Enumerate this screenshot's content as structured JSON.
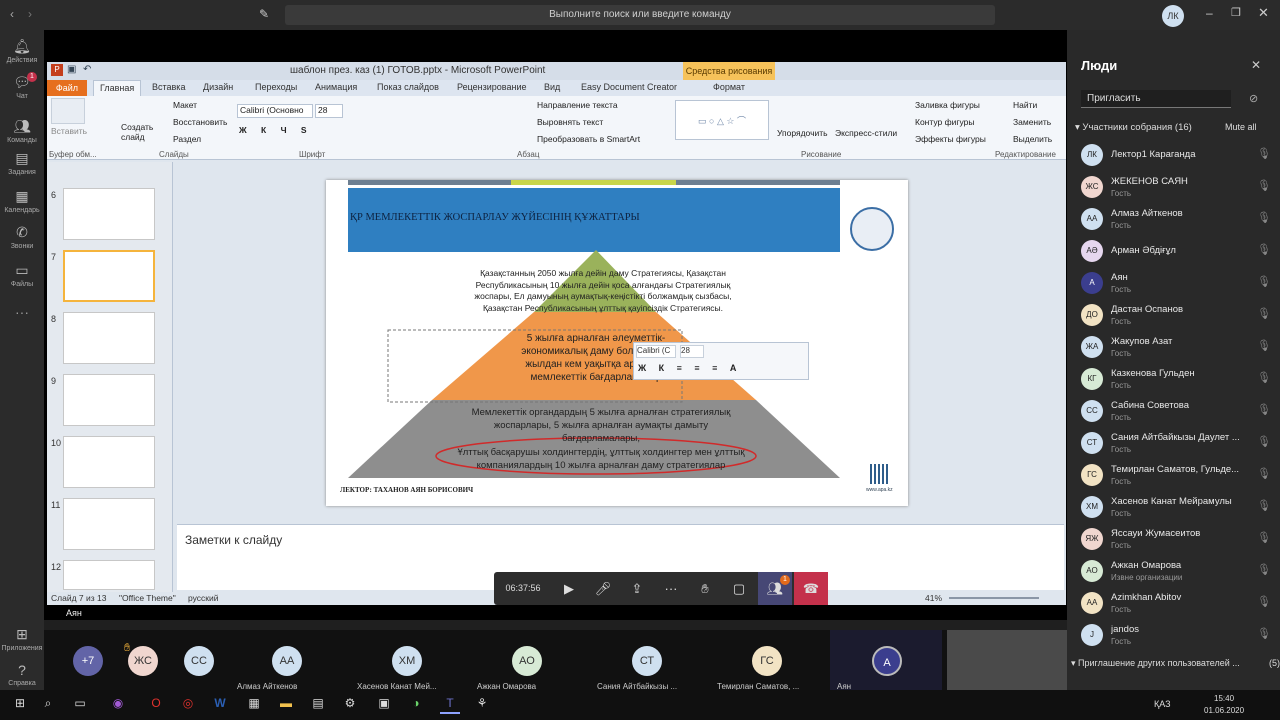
{
  "teams": {
    "search_placeholder": "Выполните поиск или введите команду",
    "user_initials": "ЛК",
    "rail": [
      {
        "label": "Действия",
        "icon": "bell-icon"
      },
      {
        "label": "Чат",
        "icon": "chat-icon",
        "badge": "1"
      },
      {
        "label": "Команды",
        "icon": "teams-icon"
      },
      {
        "label": "Задания",
        "icon": "assignments-icon"
      },
      {
        "label": "Календарь",
        "icon": "calendar-icon"
      },
      {
        "label": "Звонки",
        "icon": "phone-icon"
      },
      {
        "label": "Файлы",
        "icon": "files-icon"
      },
      {
        "label": "Приложения",
        "icon": "apps-icon"
      },
      {
        "label": "Справка",
        "icon": "help-icon"
      }
    ],
    "presenter_label": "Аян",
    "call_timer": "06:37:56",
    "participants_badge": "1"
  },
  "ppt": {
    "window_title": "шаблон през. каз (1) ГОТОВ.pptx - Microsoft PowerPoint",
    "context_tab": "Средства рисования",
    "tabs": [
      "Файл",
      "Главная",
      "Вставка",
      "Дизайн",
      "Переходы",
      "Анимация",
      "Показ слайдов",
      "Рецензирование",
      "Вид",
      "Easy Document Creator",
      "Формат"
    ],
    "ribbon": {
      "paste": "Вставить",
      "clipboard_group": "Буфер обм...",
      "new_slide": "Создать слайд",
      "layout": "Макет",
      "reset": "Восстановить",
      "section": "Раздел",
      "slides_group": "Слайды",
      "font_name": "Calibri (Основно",
      "font_size": "28",
      "font_group": "Шрифт",
      "text_direction": "Направление текста",
      "align_text": "Выровнять текст",
      "smartart": "Преобразовать в SmartArt",
      "paragraph_group": "Абзац",
      "arrange": "Упорядочить",
      "quick_styles": "Экспресс-стили",
      "shape_fill": "Заливка фигуры",
      "shape_outline": "Контур фигуры",
      "shape_effects": "Эффекты фигуры",
      "drawing_group": "Рисование",
      "find": "Найти",
      "replace": "Заменить",
      "select": "Выделить",
      "editing_group": "Редактирование"
    },
    "thumbnail_numbers": [
      "6",
      "7",
      "8",
      "9",
      "10",
      "11",
      "12"
    ],
    "slide": {
      "title": "ҚР МЕМЛЕКЕТТІК ЖОСПАРЛАУ ЖҮЙЕСІНІҢ ҚҰЖАТТАРЫ",
      "top_text": "Қазақстанның 2050 жылға дейін даму Стратегиясы, Қазақстан Республикасының 10 жылға дейін қоса алғандағы Стратегиялық жоспары, Ел дамуының аумақтық-кеңістікті болжамдық сызбасы, Қазақстан Республикасының ұлттық қауіпсіздік Стратегиясы.",
      "middle_text": "5 жылға арналған әлеуметтік-экономикалық даму болжамы, 5 жылдан кем уақытқа арналған мемлекеттік бағдарламалар",
      "bottom_text_1": "Мемлекеттік органдардың 5 жылға арналған стратегиялық жоспарлары, 5 жылға арналған аумақты дамыту бағдарламалары,",
      "bottom_text_2": "Ұлттық басқарушы холдингтердің, ұлттық холдингтер мен ұлттық компаниялардың 10 жылға арналған даму стратегиялар",
      "lecturer": "ЛЕКТОР: ТАХАНОВ АЯН БОРИСОВИЧ",
      "website": "www.apa.kz"
    },
    "mini_toolbar": {
      "font": "Calibri (С",
      "size": "28"
    },
    "notes_placeholder": "Заметки к слайду",
    "status": {
      "slide_info": "Слайд 7 из 13",
      "theme": "\"Office Theme\"",
      "language": "русский",
      "zoom": "41%"
    }
  },
  "meeting_strip": [
    {
      "initials": "+7",
      "color": "#6264a7",
      "name": ""
    },
    {
      "initials": "ЖС",
      "color": "#f0d6cf",
      "name": ""
    },
    {
      "initials": "СС",
      "color": "#cfe0f0",
      "name": ""
    },
    {
      "initials": "АА",
      "color": "#cfe0f0",
      "name": "Алмаз Айткенов"
    },
    {
      "initials": "ХМ",
      "color": "#cfe0f0",
      "name": "Хасенов Канат Мей..."
    },
    {
      "initials": "АО",
      "color": "#d7ead5",
      "name": "Ажкан Омарова"
    },
    {
      "initials": "СТ",
      "color": "#cfe0f0",
      "name": "Сания Айтбайкызы ..."
    },
    {
      "initials": "ГС",
      "color": "#f2e3c4",
      "name": "Темирлан Саматов, ..."
    },
    {
      "initials": "А",
      "color": "#3b3e8e",
      "name": "Аян"
    }
  ],
  "people_panel": {
    "title": "Люди",
    "invite_placeholder": "Пригласить",
    "participants_header": "Участники собрания (16)",
    "mute_all": "Mute all",
    "participants": [
      {
        "initials": "ЛК",
        "name": "Лектор1 Караганда",
        "role": "",
        "color": "#cfe0f0"
      },
      {
        "initials": "ЖС",
        "name": "ЖЕКЕНОВ САЯН",
        "role": "Гость",
        "color": "#f0d6cf"
      },
      {
        "initials": "АА",
        "name": "Алмаз Айткенов",
        "role": "Гость",
        "color": "#cfe0f0"
      },
      {
        "initials": "АӘ",
        "name": "Арман Әбдіғұл",
        "role": "",
        "color": "#e6d7ef"
      },
      {
        "initials": "А",
        "name": "Аян",
        "role": "Гость",
        "color": "#3b3e8e"
      },
      {
        "initials": "ДО",
        "name": "Дастан Оспанов",
        "role": "Гость",
        "color": "#f2e3c4"
      },
      {
        "initials": "ЖА",
        "name": "Жакупов Азат",
        "role": "Гость",
        "color": "#cfe0f0"
      },
      {
        "initials": "КГ",
        "name": "Казкенова Гульден",
        "role": "Гость",
        "color": "#d7ead5"
      },
      {
        "initials": "СС",
        "name": "Сабина Советова",
        "role": "Гость",
        "color": "#cfe0f0"
      },
      {
        "initials": "СТ",
        "name": "Сания Айтбайкызы Даулет ...",
        "role": "Гость",
        "color": "#cfe0f0"
      },
      {
        "initials": "ГС",
        "name": "Темирлан Саматов, Гульде...",
        "role": "Гость",
        "color": "#f2e3c4"
      },
      {
        "initials": "ХМ",
        "name": "Хасенов Канат Мейрамулы",
        "role": "Гость",
        "color": "#cfe0f0"
      },
      {
        "initials": "ЯЖ",
        "name": "Яссауи Жумасеитов",
        "role": "Гость",
        "color": "#f0d6cf"
      },
      {
        "initials": "АО",
        "name": "Ажкан Омарова",
        "role": "Извне организации",
        "color": "#d7ead5"
      },
      {
        "initials": "АА",
        "name": "Azimkhan Abitov",
        "role": "Гость",
        "color": "#f2e3c4"
      },
      {
        "initials": "J",
        "name": "jandos",
        "role": "Гость",
        "color": "#cfe0f0"
      }
    ],
    "invite_others_header": "Приглашение других пользователей ...",
    "invite_others_count": "(5)"
  },
  "taskbar": {
    "lang": "ҚАЗ",
    "time": "15:40",
    "date": "01.06.2020"
  }
}
